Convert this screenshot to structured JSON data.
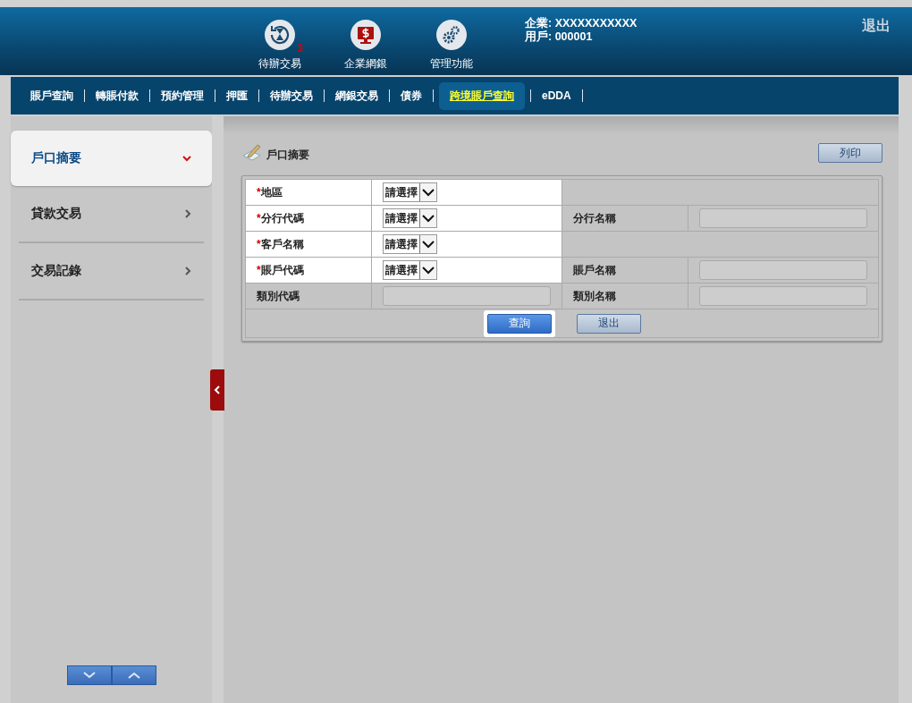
{
  "header": {
    "shortcuts": [
      {
        "kind": "hourglass",
        "label": "待辦交易",
        "badge": "3"
      },
      {
        "kind": "monitor",
        "label": "企業網銀"
      },
      {
        "kind": "gears",
        "label": "管理功能"
      }
    ],
    "company": "企業: XXXXXXXXXXX",
    "user": "用戶: 000001",
    "logout": "退出"
  },
  "tabs": [
    {
      "label": "賬戶查詢",
      "selected": false
    },
    {
      "label": "轉賬付款",
      "selected": false
    },
    {
      "label": "預約管理",
      "selected": false
    },
    {
      "label": "押匯",
      "selected": false
    },
    {
      "label": "待辦交易",
      "selected": false
    },
    {
      "label": "網銀交易",
      "selected": false
    },
    {
      "label": "債券",
      "selected": false
    },
    {
      "label": "跨境賬戶查詢",
      "selected": true
    },
    {
      "label": "eDDA",
      "selected": false
    }
  ],
  "sidebar": {
    "items": [
      {
        "label": "戶口摘要",
        "expanded": true
      },
      {
        "label": "貸款交易",
        "expanded": false
      },
      {
        "label": "交易記錄",
        "expanded": false
      }
    ]
  },
  "page": {
    "title": "戶口摘要",
    "print_button": "列印"
  },
  "form": {
    "rows": [
      {
        "label": "地區",
        "required_mark": "*",
        "field": {
          "kind": "select",
          "value": "請選擇"
        }
      },
      {
        "label": "分行代碼",
        "required_mark": "*",
        "field": {
          "kind": "select",
          "value": "請選擇"
        },
        "right": {
          "label": "分行名稱"
        }
      },
      {
        "label": "客戶名稱",
        "required_mark": "*",
        "field": {
          "kind": "select",
          "value": "請選擇"
        }
      },
      {
        "label": "賬戶代碼",
        "required_mark": "*",
        "field": {
          "kind": "select",
          "value": "請選擇"
        },
        "right": {
          "label": "賬戶名稱"
        }
      },
      {
        "label": "類別代碼",
        "field": {
          "kind": "readonly"
        },
        "right": {
          "label": "類別名稱"
        }
      }
    ],
    "buttons": [
      {
        "label": "查詢",
        "kind": "primary"
      },
      {
        "label": "退出",
        "kind": "secondary"
      }
    ]
  }
}
